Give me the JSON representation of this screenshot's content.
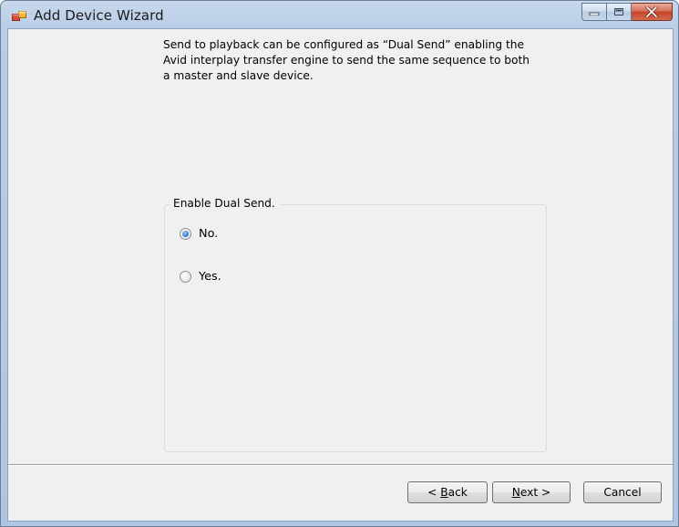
{
  "window": {
    "title": "Add Device Wizard"
  },
  "description": "Send to playback can be configured as “Dual Send” enabling the Avid interplay transfer engine to send the same sequence to both a master and slave device.",
  "group": {
    "legend": "Enable Dual Send.",
    "options": [
      {
        "label": "No.",
        "checked": true
      },
      {
        "label": "Yes.",
        "checked": false
      }
    ]
  },
  "buttons": {
    "back_prefix": "< ",
    "back_mnemonic": "B",
    "back_rest": "ack",
    "next_mnemonic": "N",
    "next_rest": "ext >",
    "cancel": "Cancel"
  },
  "icons": {
    "app": "wizard-window-icon",
    "minimize": "minimize-icon",
    "maximize": "maximize-icon",
    "close": "close-icon"
  }
}
